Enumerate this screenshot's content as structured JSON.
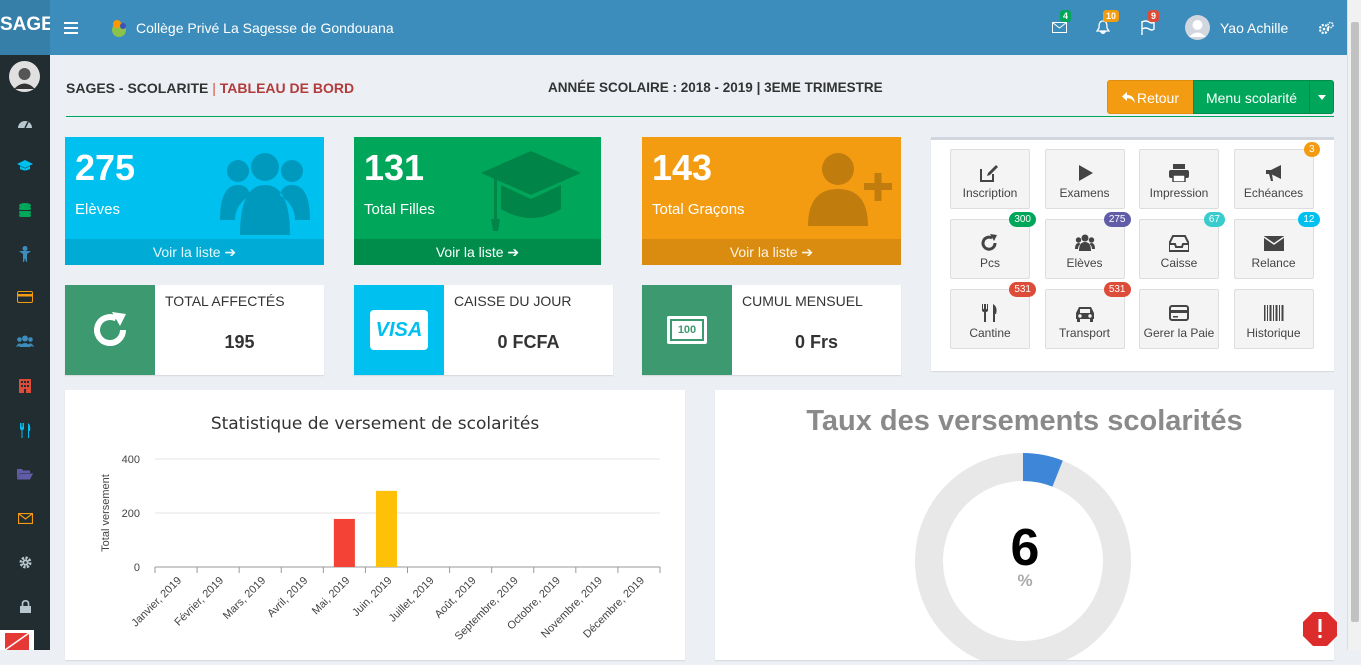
{
  "brand": "SAGE",
  "header": {
    "school": "Collège Privé La Sagesse de Gondouana",
    "mail_count": "4",
    "bell_count": "10",
    "flag_count": "9",
    "user_name": "Yao Achille"
  },
  "page": {
    "title": "SAGES - SCOLARITE",
    "separator": "|",
    "subtitle": "TABLEAU DE BORD",
    "year": "ANNÉE SCOLAIRE : 2018 - 2019 | 3EME TRIMESTRE",
    "back_label": "Retour",
    "menu_label": "Menu scolarité"
  },
  "stats": [
    {
      "num": "275",
      "label": "Elèves",
      "link": "Voir la liste",
      "color": "#00c0ef"
    },
    {
      "num": "131",
      "label": "Total Filles",
      "link": "Voir la liste",
      "color": "#00a65a"
    },
    {
      "num": "143",
      "label": "Total Graçons",
      "link": "Voir la liste",
      "color": "#f39c12"
    }
  ],
  "infos": [
    {
      "label": "TOTAL AFFECTÉS",
      "value": "195",
      "color": "#3d9970",
      "icon": "refresh-icon"
    },
    {
      "label": "CAISSE DU JOUR",
      "value": "0 FCFA",
      "color": "#00c0ef",
      "icon": "visa-icon",
      "icon_text": "VISA"
    },
    {
      "label": "CUMUL MENSUEL",
      "value": "0 Frs",
      "color": "#3d9970",
      "icon": "money-icon",
      "icon_text": "100"
    }
  ],
  "tiles": [
    {
      "label": "Inscription",
      "badge": "",
      "icon": "edit-icon"
    },
    {
      "label": "Examens",
      "badge": "",
      "icon": "play-icon"
    },
    {
      "label": "Impression",
      "badge": "",
      "icon": "print-icon"
    },
    {
      "label": "Echéances",
      "badge": "3",
      "badge_color": "#f39c12",
      "icon": "bullhorn-icon"
    },
    {
      "label": "Pcs",
      "badge": "300",
      "badge_color": "#00a65a",
      "icon": "refresh-icon"
    },
    {
      "label": "Elèves",
      "badge": "275",
      "badge_color": "#605ca8",
      "icon": "users-icon"
    },
    {
      "label": "Caisse",
      "badge": "67",
      "badge_color": "#39cccc",
      "icon": "inbox-icon"
    },
    {
      "label": "Relance",
      "badge": "12",
      "badge_color": "#00c0ef",
      "icon": "envelope-icon"
    },
    {
      "label": "Cantine",
      "badge": "531",
      "badge_color": "#dd4b39",
      "icon": "cutlery-icon"
    },
    {
      "label": "Transport",
      "badge": "531",
      "badge_color": "#dd4b39",
      "icon": "car-icon"
    },
    {
      "label": "Gerer la Paie",
      "badge": "",
      "icon": "credit-card-icon"
    },
    {
      "label": "Historique",
      "badge": "",
      "icon": "barcode-icon"
    }
  ],
  "chart_data": {
    "type": "bar",
    "title": "Statistique de versement de scolarités",
    "ylabel": "Total versement",
    "ylim": [
      0,
      400
    ],
    "yticks": [
      0,
      200,
      400
    ],
    "categories": [
      "Janvier, 2019",
      "Février, 2019",
      "Mars, 2019",
      "Avril, 2019",
      "Mai, 2019",
      "Juin, 2019",
      "Juillet, 2019",
      "Août, 2019",
      "Septembre, 2019",
      "Octobre, 2019",
      "Novembre, 2019",
      "Décembre, 2019"
    ],
    "values": [
      0,
      0,
      0,
      0,
      178,
      282,
      0,
      0,
      0,
      0,
      0,
      0
    ],
    "colors": [
      "#00c0ef",
      "#00a65a",
      "#f39c12",
      "#3c8dbc",
      "#f44336",
      "#ffc107",
      "#00c0ef",
      "#00a65a",
      "#f39c12",
      "#3c8dbc",
      "#605ca8",
      "#d81b60"
    ]
  },
  "gauge": {
    "title": "Taux des versements scolarités",
    "value": "6",
    "unit": "%",
    "fraction": 0.06
  }
}
